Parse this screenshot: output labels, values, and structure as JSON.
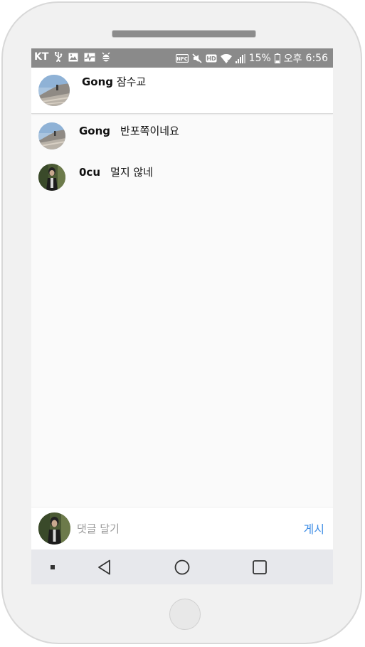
{
  "status_bar": {
    "carrier": "KT",
    "battery_percent": "15%",
    "ampm": "오후",
    "time": "6:56",
    "icons": [
      "usb-icon",
      "image-icon",
      "activity-icon",
      "bug-icon",
      "nfc-icon",
      "mute-icon",
      "hd-icon",
      "wifi-icon",
      "signal-icon",
      "battery-icon"
    ]
  },
  "post": {
    "username": "Gong",
    "caption": "잠수교"
  },
  "comments": [
    {
      "username": "Gong",
      "text": "반포쪽이네요"
    },
    {
      "username": "0cu",
      "text": "멀지 않네"
    }
  ],
  "input_bar": {
    "placeholder": "댓글 달기",
    "post_label": "게시"
  },
  "nav": {
    "buttons": [
      "menu-icon",
      "back-icon",
      "home-icon",
      "recents-icon"
    ]
  },
  "colors": {
    "status_bar": "#8a8a8a",
    "accent": "#3f8ee6",
    "nav_bar": "#e7e8ec"
  }
}
